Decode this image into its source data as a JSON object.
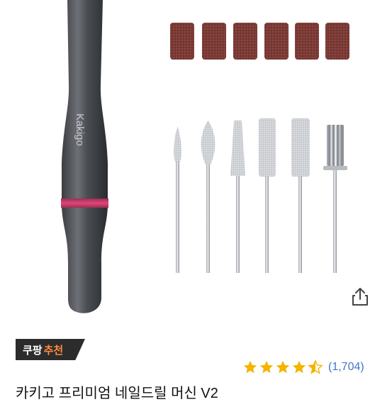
{
  "product": {
    "brand_on_device": "Kakigo",
    "badge": {
      "label_part1": "쿠팡",
      "label_part2": "추천"
    },
    "rating": {
      "stars": 4.5,
      "count_label": "(1,704)"
    },
    "title": "카키고 프리미엄 네일드릴 머신 V2"
  },
  "icons": {
    "share": "share-icon",
    "star": "star-icon"
  },
  "colors": {
    "star": "#f5b400",
    "review_link": "#3f77c9",
    "badge_bg": "#2c2c2c",
    "badge_accent": "#ff8a3d",
    "accent_ring": "#e0457c"
  }
}
